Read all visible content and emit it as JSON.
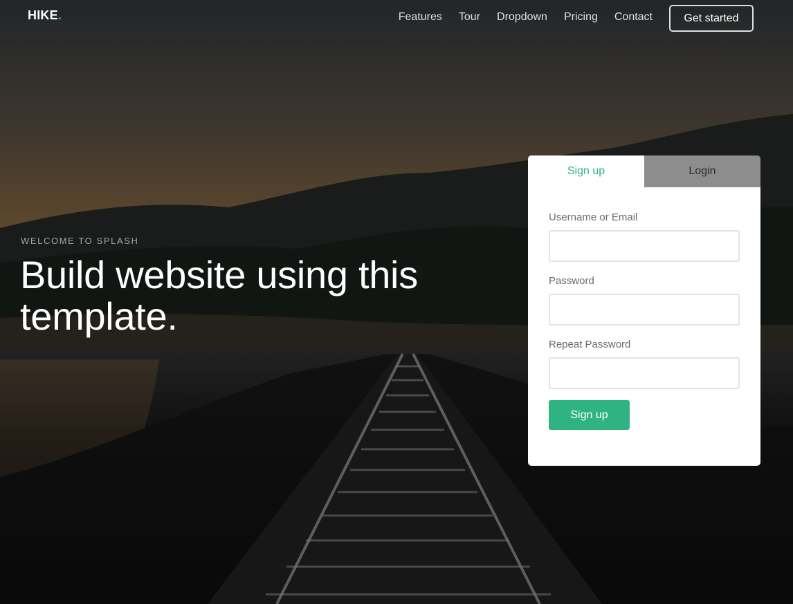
{
  "nav": {
    "brand": "HIKE",
    "brand_dot": ".",
    "links": [
      "Features",
      "Tour",
      "Dropdown",
      "Pricing",
      "Contact"
    ],
    "cta": "Get started"
  },
  "hero": {
    "eyebrow": "WELCOME TO SPLASH",
    "title": "Build website using this template."
  },
  "form": {
    "tabs": [
      "Sign up",
      "Login"
    ],
    "active_tab": "Sign up",
    "fields": [
      {
        "label": "Username or Email",
        "value": "",
        "placeholder": ""
      },
      {
        "label": "Password",
        "value": "",
        "placeholder": ""
      },
      {
        "label": "Repeat Password",
        "value": "",
        "placeholder": ""
      }
    ],
    "submit": "Sign up"
  },
  "colors": {
    "accent": "#2fb383",
    "inactive_tab": "#8d8d8d",
    "card": "#ffffff"
  },
  "icons": []
}
